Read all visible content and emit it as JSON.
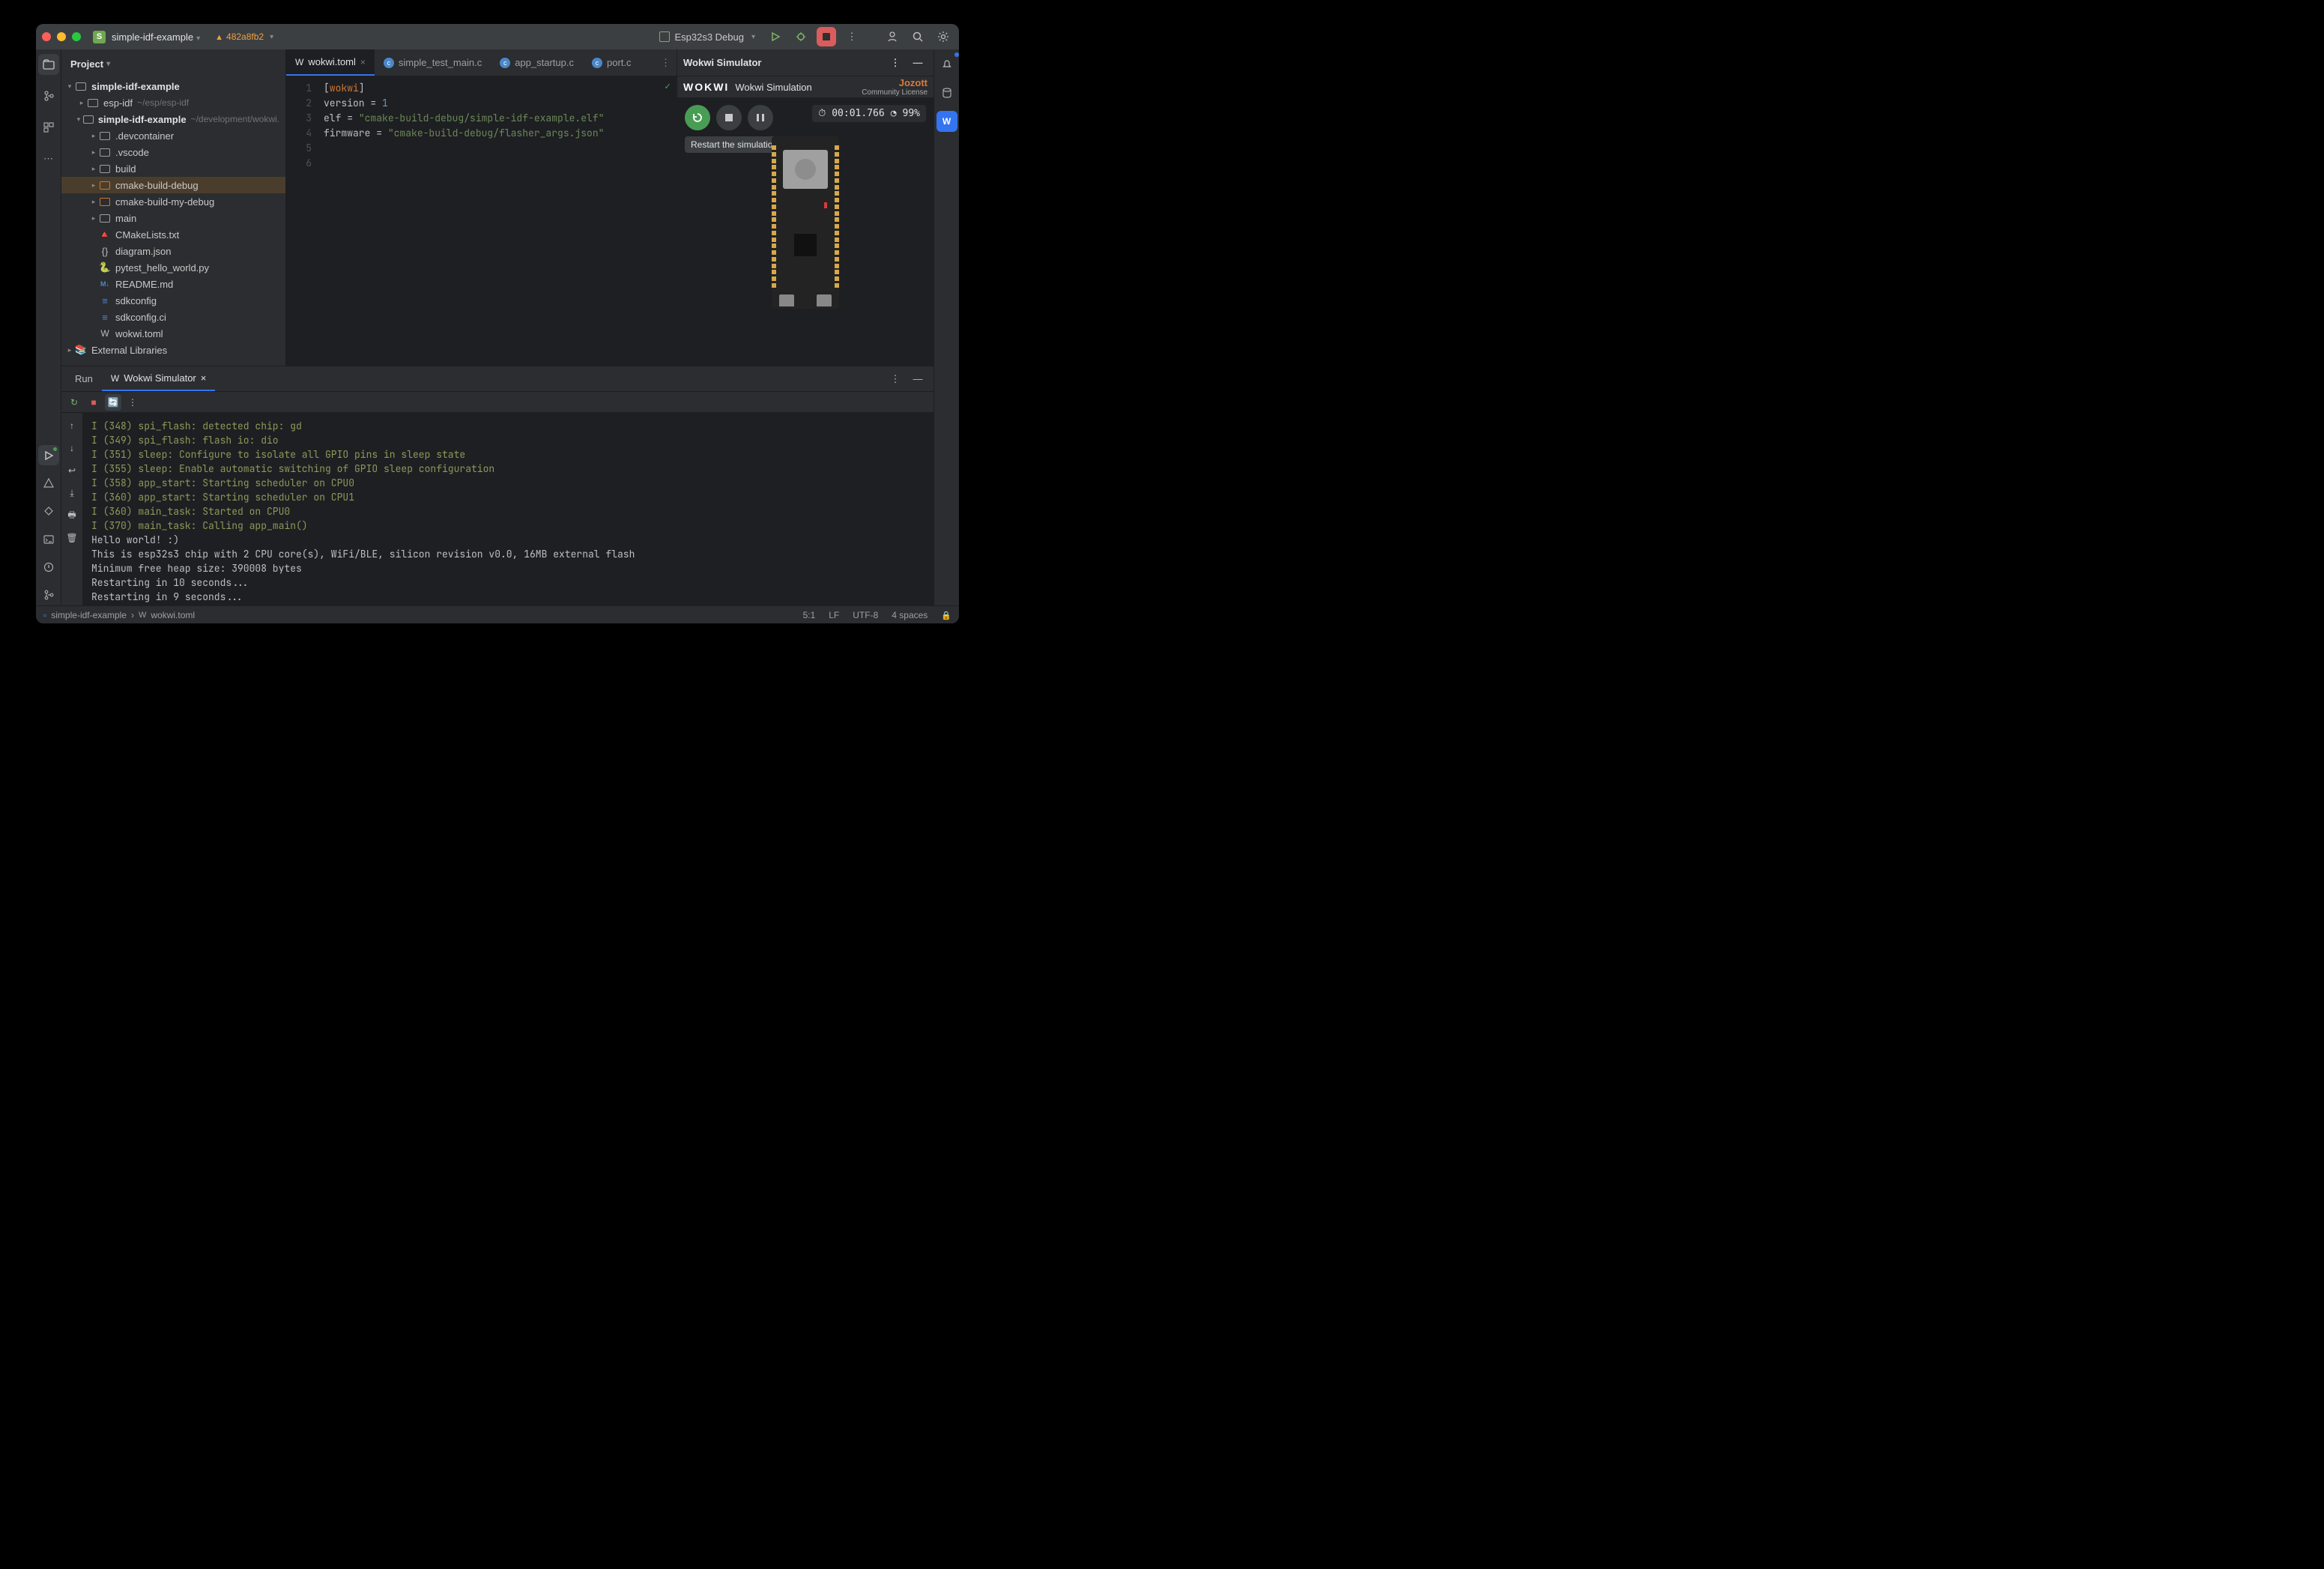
{
  "titlebar": {
    "project_initial": "S",
    "project_name": "simple-idf-example",
    "vcs_warning": "482a8fb2",
    "run_config": "Esp32s3 Debug"
  },
  "project_panel": {
    "header": "Project",
    "tree": {
      "root": "simple-idf-example",
      "esp_idf": "esp-idf",
      "esp_idf_hint": "~/esp/esp-idf",
      "module": "simple-idf-example",
      "module_hint": "~/development/wokwi.",
      "devcontainer": ".devcontainer",
      "vscode": ".vscode",
      "build": "build",
      "cmake_build_debug": "cmake-build-debug",
      "cmake_build_my_debug": "cmake-build-my-debug",
      "main": "main",
      "cmakelists": "CMakeLists.txt",
      "diagram": "diagram.json",
      "pytest": "pytest_hello_world.py",
      "readme": "README.md",
      "sdkconfig": "sdkconfig",
      "sdkconfig_ci": "sdkconfig.ci",
      "wokwi_toml": "wokwi.toml",
      "ext_libs": "External Libraries"
    }
  },
  "editor": {
    "tabs": {
      "t0": "wokwi.toml",
      "t1": "simple_test_main.c",
      "t2": "app_startup.c",
      "t3": "port.c"
    },
    "code": {
      "l1_open": "[",
      "l1_sec": "wokwi",
      "l1_close": "]",
      "l2_key": "version",
      "l2_eq": " = ",
      "l2_val": "1",
      "l3_key": "elf",
      "l3_eq": " = ",
      "l3_val": "\"cmake-build-debug/simple-idf-example.elf\"",
      "l4_key": "firmware",
      "l4_eq": " = ",
      "l4_val": "\"cmake-build-debug/flasher_args.json\""
    },
    "line_numbers": [
      "1",
      "2",
      "3",
      "4",
      "5",
      "6"
    ]
  },
  "wokwi": {
    "panel_title": "Wokwi Simulator",
    "logo": "WOKWI",
    "sim_title": "Wokwi Simulation",
    "user": "Jozott",
    "license": "Community License",
    "time": "00:01.766",
    "perf": "99%",
    "tooltip": "Restart the simulation"
  },
  "bottom_panel": {
    "tab_run": "Run",
    "tab_wokwi": "Wokwi Simulator",
    "console_lines": [
      {
        "cls": "log-info",
        "t": "I (348) spi_flash: detected chip: gd"
      },
      {
        "cls": "log-info",
        "t": "I (349) spi_flash: flash io: dio"
      },
      {
        "cls": "log-info",
        "t": "I (351) sleep: Configure to isolate all GPIO pins in sleep state"
      },
      {
        "cls": "log-info",
        "t": "I (355) sleep: Enable automatic switching of GPIO sleep configuration"
      },
      {
        "cls": "log-info",
        "t": "I (358) app_start: Starting scheduler on CPU0"
      },
      {
        "cls": "log-info",
        "t": "I (360) app_start: Starting scheduler on CPU1"
      },
      {
        "cls": "log-info",
        "t": "I (360) main_task: Started on CPU0"
      },
      {
        "cls": "log-info",
        "t": "I (370) main_task: Calling app_main()"
      },
      {
        "cls": "log-plain",
        "t": "Hello world! :)"
      },
      {
        "cls": "log-plain",
        "t": "This is esp32s3 chip with 2 CPU core(s), WiFi/BLE, silicon revision v0.0, 16MB external flash"
      },
      {
        "cls": "log-plain",
        "t": "Minimum free heap size: 390008 bytes"
      },
      {
        "cls": "log-plain",
        "t": "Restarting in 10 seconds..."
      },
      {
        "cls": "log-plain",
        "t": "Restarting in 9 seconds..."
      }
    ]
  },
  "statusbar": {
    "crumb1": "simple-idf-example",
    "crumb2": "wokwi.toml",
    "pos": "5:1",
    "eol": "LF",
    "enc": "UTF-8",
    "indent": "4 spaces"
  }
}
